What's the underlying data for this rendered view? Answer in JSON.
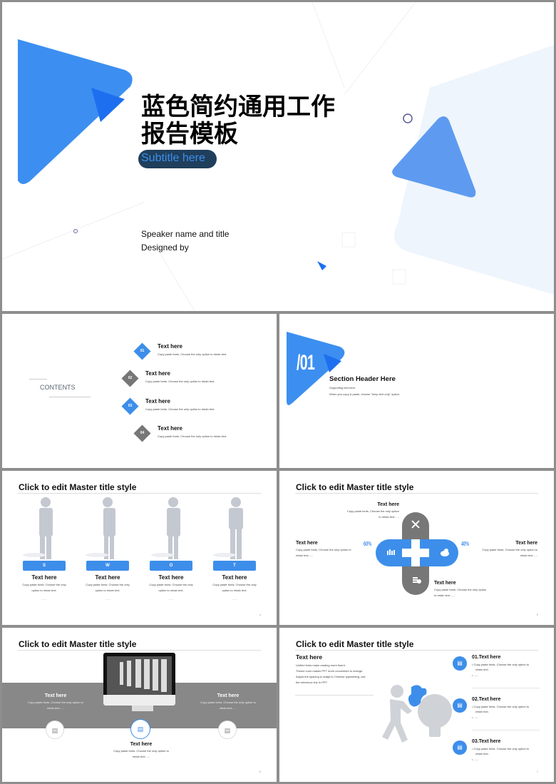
{
  "colors": {
    "accent": "#3d8eea",
    "accent_dark": "#1e6ff0",
    "gray": "#777777",
    "navy": "#1f3f5c"
  },
  "slide1": {
    "title_line1": "蓝色简约通用工作",
    "title_line2": "报告模板",
    "subtitle": "Subtitle here",
    "speaker": "Speaker name and title",
    "designed_by": "Designed by"
  },
  "slide2": {
    "heading": "CONTENTS",
    "items": [
      {
        "num": "01",
        "title": "Text here",
        "desc": "Copy paste fonts. Choose the only option to retain text."
      },
      {
        "num": "02",
        "title": "Text here",
        "desc": "Copy paste fonts. Choose the only option to retain text."
      },
      {
        "num": "03",
        "title": "Text here",
        "desc": "Copy paste fonts. Choose the only option to retain text."
      },
      {
        "num": "04",
        "title": "Text here",
        "desc": "Copy paste fonts. Choose the only option to retain text."
      }
    ]
  },
  "slide3": {
    "number": "/01",
    "header": "Section Header Here",
    "line1": "Supporting text here.",
    "line2": "When you copy & paste, choose \"keep text only\" option."
  },
  "slide4": {
    "title": "Click to edit Master title style",
    "page": "4",
    "items": [
      {
        "letter": "S",
        "title": "Text here",
        "desc1": "Copy paste fonts. Choose the only",
        "desc2": "option to retain text.",
        "dash": "——"
      },
      {
        "letter": "W",
        "title": "Text here",
        "desc1": "Copy paste fonts. Choose the only",
        "desc2": "option to retain text.",
        "dash": "——"
      },
      {
        "letter": "O",
        "title": "Text here",
        "desc1": "Copy paste fonts. Choose the only",
        "desc2": "option to retain text.",
        "dash": "——"
      },
      {
        "letter": "T",
        "title": "Text here",
        "desc1": "Copy paste fonts. Choose the only",
        "desc2": "option to retain text.",
        "dash": "——"
      }
    ]
  },
  "slide5": {
    "title": "Click to edit Master title style",
    "page": "5",
    "top": {
      "title": "Text here",
      "desc1": "Copy paste fonts. Choose the only option",
      "desc2": "to retain text......"
    },
    "left": {
      "title": "Text here",
      "percent": "60%",
      "desc1": "Copy paste fonts. Choose the only option to",
      "desc2": "retain text......"
    },
    "right": {
      "title": "Text here",
      "percent": "40%",
      "desc1": "Copy paste fonts. Choose the only option to",
      "desc2": "retain text......"
    },
    "bottom": {
      "title": "Text here",
      "desc1": "Copy paste fonts. Choose the only option",
      "desc2": "to retain text......"
    }
  },
  "slide6": {
    "title": "Click to edit Master title style",
    "page": "6",
    "left": {
      "title": "Text here",
      "desc1": "Copy paste fonts. Choose the only option to",
      "desc2": "retain text......"
    },
    "right": {
      "title": "Text here",
      "desc1": "Copy paste fonts. Choose the only option to",
      "desc2": "retain text......"
    },
    "center": {
      "title": "Text here",
      "desc1": "Copy paste fonts. Choose the only option to",
      "desc2": "retain text......"
    }
  },
  "slide7": {
    "title": "Click to edit Master title style",
    "page": "7",
    "intro_title": "Text here",
    "intro_lines": [
      "Unified fonts make reading more fluent.",
      "Theme color makes PPT more convenient to change.",
      "Adjust the spacing to adapt to Chinese typesetting, use",
      "the reference line in PPT."
    ],
    "items": [
      {
        "title": "01.Text here",
        "bullet1": "Copy paste fonts. Choose the only option to",
        "bullet1b": "retain text.",
        "bullet2": "......"
      },
      {
        "title": "02.Text here",
        "bullet1": "Copy paste fonts. Choose the only option to",
        "bullet1b": "retain text.",
        "bullet2": "......"
      },
      {
        "title": "03.Text here",
        "bullet1": "Copy paste fonts. Choose the only option to",
        "bullet1b": "retain text.",
        "bullet2": "......"
      }
    ]
  }
}
